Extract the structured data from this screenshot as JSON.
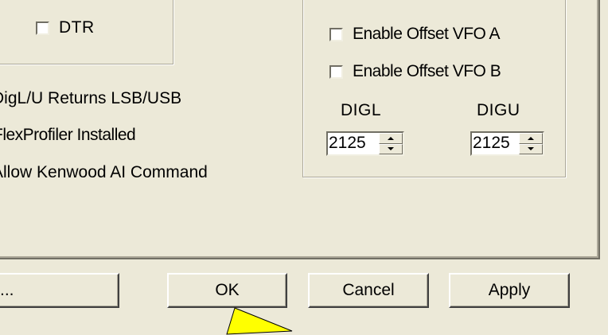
{
  "left_panel": {
    "dtr_label": "DTR",
    "digl_returns_label": "DigL/U Returns LSB/USB",
    "flexprofiler_label": "FlexProfiler Installed",
    "kenwood_ai_label": "Allow Kenwood AI Command"
  },
  "offset_group": {
    "enable_offset_a_label": "Enable Offset VFO A",
    "enable_offset_b_label": "Enable Offset VFO B",
    "digl_label": "DIGL",
    "digu_label": "DIGU",
    "digl_value": "2125",
    "digu_value": "2125"
  },
  "buttons": {
    "ellipsis_label": "...",
    "ok_label": "OK",
    "cancel_label": "Cancel",
    "apply_label": "Apply"
  },
  "colors": {
    "window_bg": "#ece9d8",
    "pointer_fill": "#ffff00"
  }
}
